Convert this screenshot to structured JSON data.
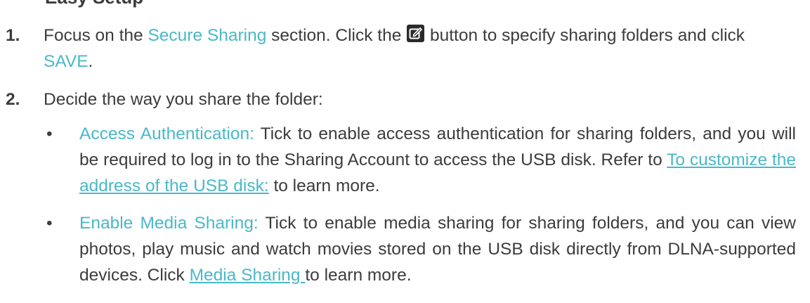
{
  "heading": "Easy Setup",
  "steps": [
    {
      "number": "1.",
      "text_a": "Focus on the ",
      "highlight_a": "Secure Sharing",
      "text_b": " section. Click the ",
      "icon": "edit-icon",
      "text_c": " button to specify sharing folders and click ",
      "highlight_b": "SAVE",
      "text_d": "."
    },
    {
      "number": "2.",
      "text": "Decide the way you share the folder:"
    }
  ],
  "bullets": [
    {
      "symbol": "•",
      "label": "Access Authentication:",
      "text_a": " Tick to enable access authentication for sharing folders, and you will be required to log in to the Sharing Account to access the USB disk. Refer to ",
      "link": "To customize the address of the USB disk:",
      "text_b": " to learn more."
    },
    {
      "symbol": "•",
      "label": "Enable Media Sharing:",
      "text_a": " Tick to enable media sharing for sharing folders, and you can view photos, play music and watch movies stored on the USB disk directly from DLNA-supported devices. Click ",
      "link": "Media Sharing ",
      "text_b": "to learn more."
    }
  ],
  "colors": {
    "highlight": "#4ab8c8",
    "text": "#3c3c3c",
    "icon_bg": "#2b2b2b"
  }
}
